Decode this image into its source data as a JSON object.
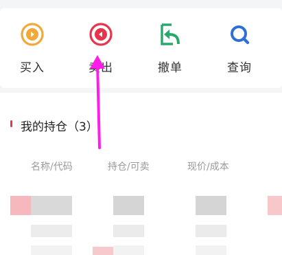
{
  "actions": {
    "buy": {
      "label": "买入",
      "icon": "buy-icon",
      "color": "#f0a93a"
    },
    "sell": {
      "label": "卖出",
      "icon": "sell-icon",
      "color": "#e8344b"
    },
    "cancel": {
      "label": "撤单",
      "icon": "cancel-order-icon",
      "color": "#2aa86a"
    },
    "query": {
      "label": "查询",
      "icon": "query-icon",
      "color": "#2e6fd8"
    }
  },
  "holdings": {
    "title": "我的持仓（3）",
    "columns": [
      "名称/代码",
      "持仓/可卖",
      "现价/成本"
    ]
  },
  "annotation": {
    "arrow_color": "#ff1ee8"
  }
}
